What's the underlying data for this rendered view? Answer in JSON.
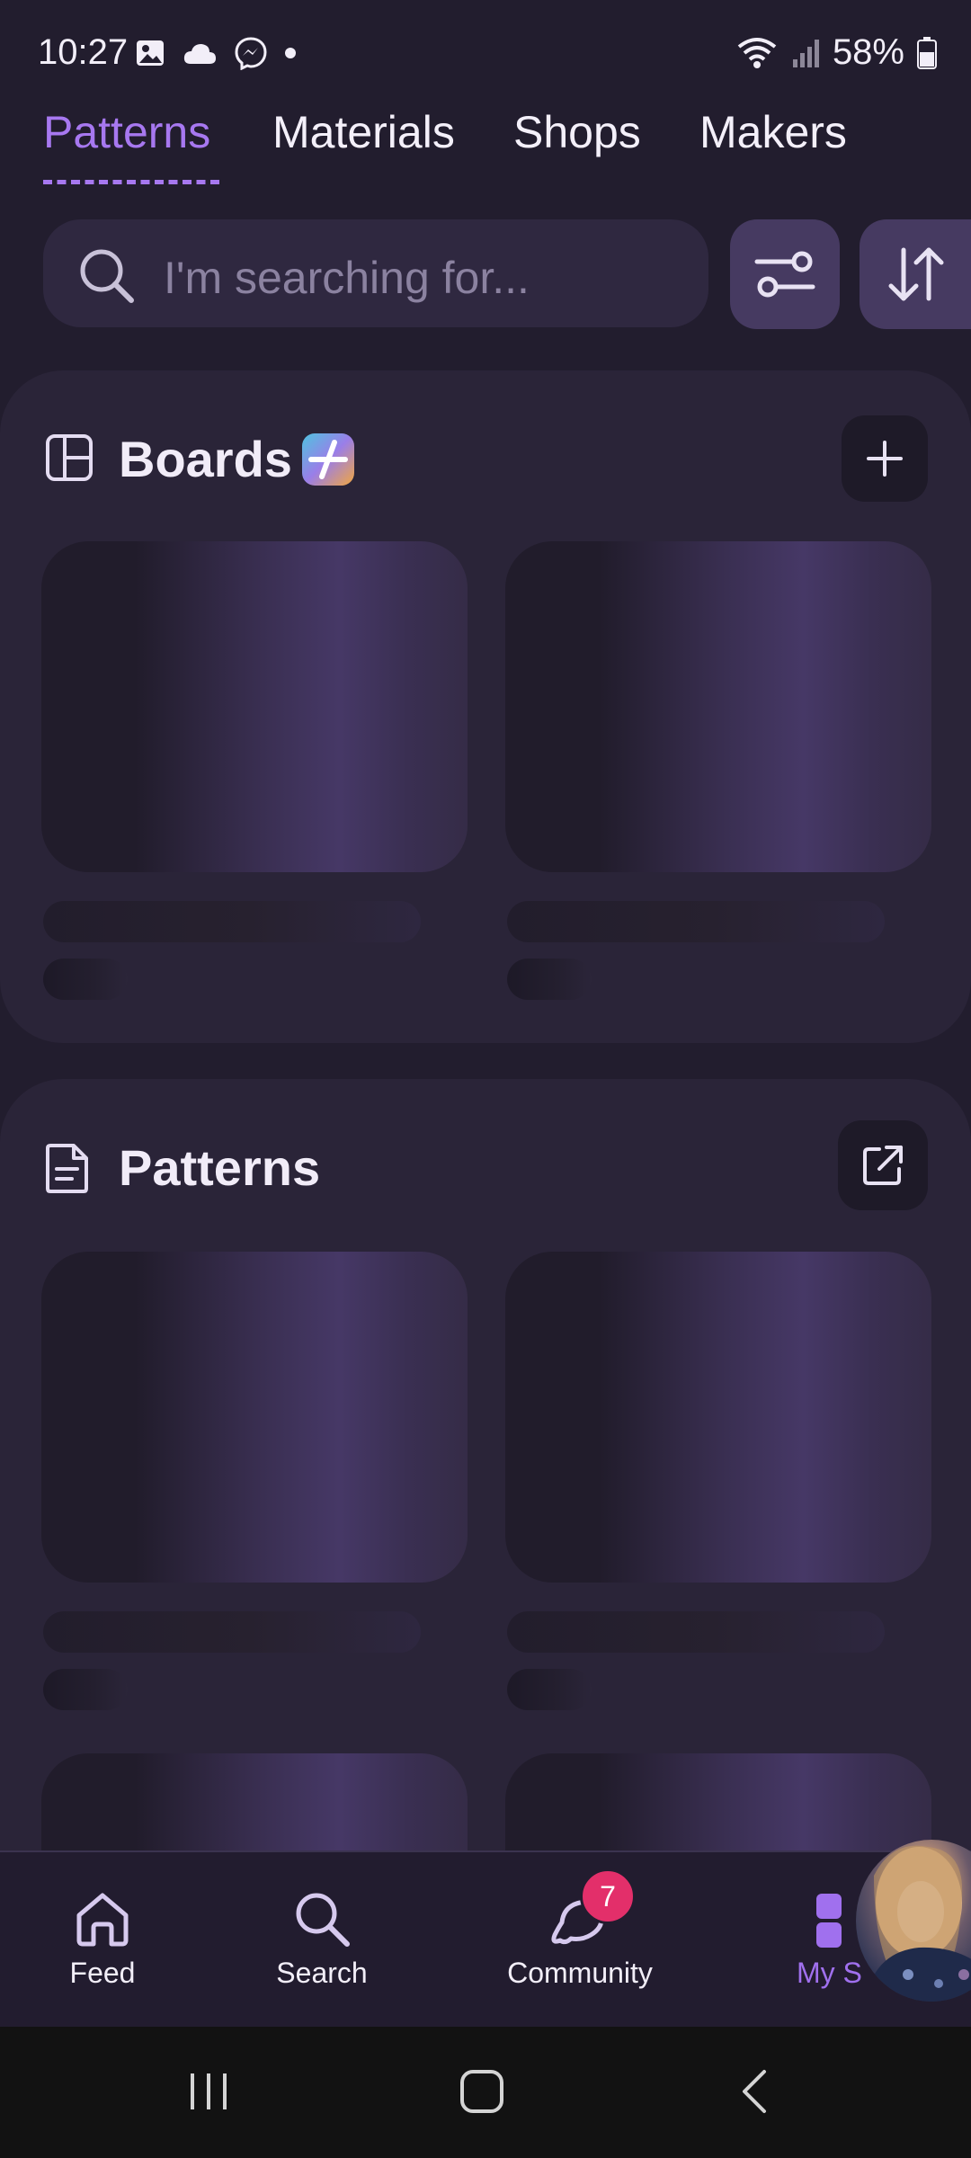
{
  "status_bar": {
    "time": "10:27",
    "battery": "58%",
    "left_icons": [
      "gallery-icon",
      "cloud-icon",
      "messenger-icon",
      "dot-icon"
    ],
    "right_icons": [
      "wifi-icon",
      "signal-icon",
      "battery-icon"
    ]
  },
  "tabs": [
    {
      "label": "Patterns",
      "active": true
    },
    {
      "label": "Materials",
      "active": false
    },
    {
      "label": "Shops",
      "active": false
    },
    {
      "label": "Makers",
      "active": false
    }
  ],
  "search": {
    "placeholder": "I'm searching for..."
  },
  "sections": [
    {
      "title": "Boards",
      "icon": "board-icon",
      "badge_icon": "plus-badge-icon",
      "action_icon": "plus-icon"
    },
    {
      "title": "Patterns",
      "icon": "document-icon",
      "action_icon": "external-link-icon"
    }
  ],
  "bottom_nav": [
    {
      "label": "Feed",
      "icon": "home-icon",
      "active": false
    },
    {
      "label": "Search",
      "icon": "search-icon",
      "active": false
    },
    {
      "label": "Community",
      "icon": "community-icon",
      "active": false,
      "badge": "7"
    },
    {
      "label": "My S",
      "icon": "my-stuff-icon",
      "active": true
    }
  ],
  "colors": {
    "accent": "#a778f0",
    "background": "#221d2e",
    "card": "#2a2438",
    "badge": "#e32f6a"
  }
}
